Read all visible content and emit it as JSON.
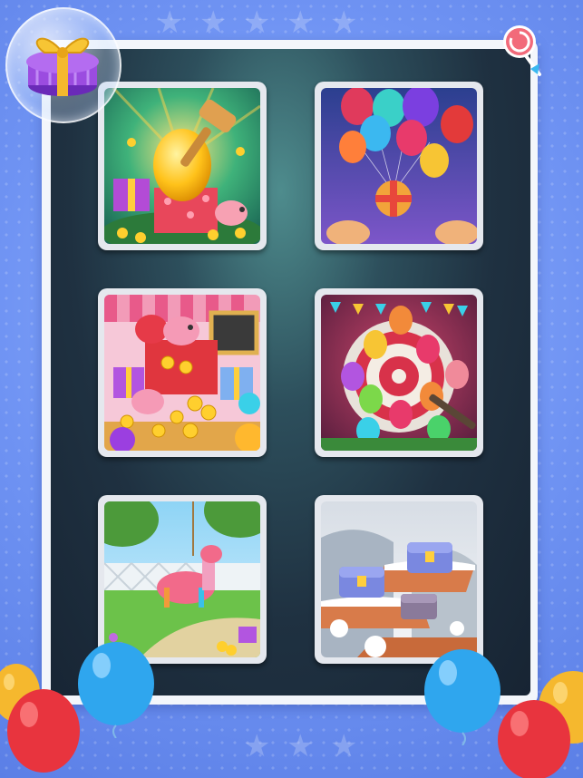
{
  "screen": {
    "title": "",
    "colors": {
      "background": "#6f93f3",
      "frame": "#f3f6fb",
      "board": "#1f3141",
      "tile_border": "#e5e8ee"
    }
  },
  "header": {
    "gift_icon": "gift-box-icon",
    "candy_icon": "lollipop-icon"
  },
  "scenes": [
    {
      "name": "golden-egg-smash",
      "icons": [
        "golden-egg",
        "hammer",
        "piggy-bank",
        "gift-box",
        "coins"
      ]
    },
    {
      "name": "balloon-gift-release",
      "icons": [
        "balloons",
        "gift-box",
        "hands"
      ]
    },
    {
      "name": "treasure-gift-pile",
      "icons": [
        "piggy-bank",
        "coins",
        "gift-box",
        "chalkboard"
      ]
    },
    {
      "name": "balloon-dart-target",
      "icons": [
        "target-wheel",
        "balloons",
        "dart"
      ]
    },
    {
      "name": "pinata-garden",
      "icons": [
        "llama-pinata",
        "fence",
        "tree",
        "coins"
      ]
    },
    {
      "name": "snowy-treasure-chests",
      "icons": [
        "treasure-chest",
        "snow",
        "rocks"
      ]
    }
  ],
  "decorations": [
    "balloons",
    "stars"
  ]
}
